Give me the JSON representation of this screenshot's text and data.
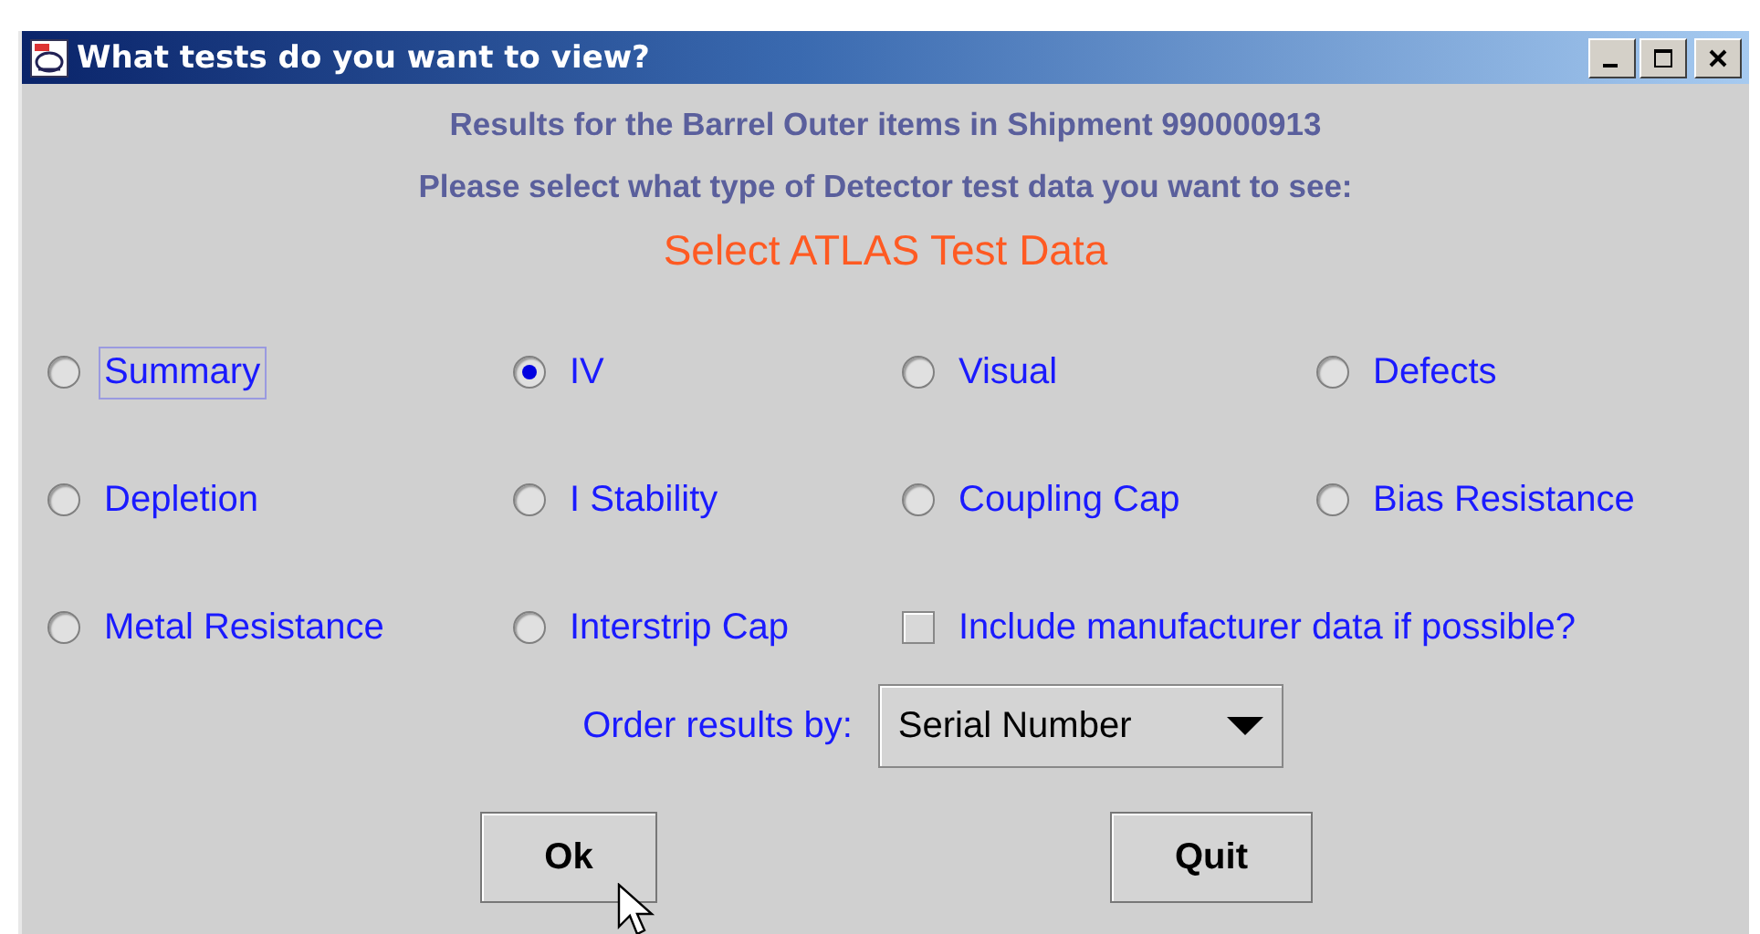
{
  "window": {
    "title": "What tests do you want to view?"
  },
  "header": {
    "line_1": "Results for the Barrel Outer items in Shipment 990000913",
    "line_2": "Please select what type of Detector test data you want to see:",
    "subtitle": "Select ATLAS Test Data"
  },
  "options": [
    {
      "kind": "radio",
      "label": "Summary",
      "selected": false,
      "focused": true
    },
    {
      "kind": "radio",
      "label": "IV",
      "selected": true,
      "focused": false
    },
    {
      "kind": "radio",
      "label": "Visual",
      "selected": false,
      "focused": false
    },
    {
      "kind": "radio",
      "label": "Defects",
      "selected": false,
      "focused": false
    },
    {
      "kind": "radio",
      "label": "Depletion",
      "selected": false,
      "focused": false
    },
    {
      "kind": "radio",
      "label": "I Stability",
      "selected": false,
      "focused": false
    },
    {
      "kind": "radio",
      "label": "Coupling Cap",
      "selected": false,
      "focused": false
    },
    {
      "kind": "radio",
      "label": "Bias Resistance",
      "selected": false,
      "focused": false
    },
    {
      "kind": "radio",
      "label": "Metal Resistance",
      "selected": false,
      "focused": false
    },
    {
      "kind": "radio",
      "label": "Interstrip Cap",
      "selected": false,
      "focused": false
    },
    {
      "kind": "checkbox",
      "label": "Include manufacturer data if possible?",
      "checked": false,
      "focused": false
    }
  ],
  "order": {
    "label": "Order results by:",
    "value": "Serial Number"
  },
  "buttons": [
    "Ok",
    "Quit"
  ]
}
